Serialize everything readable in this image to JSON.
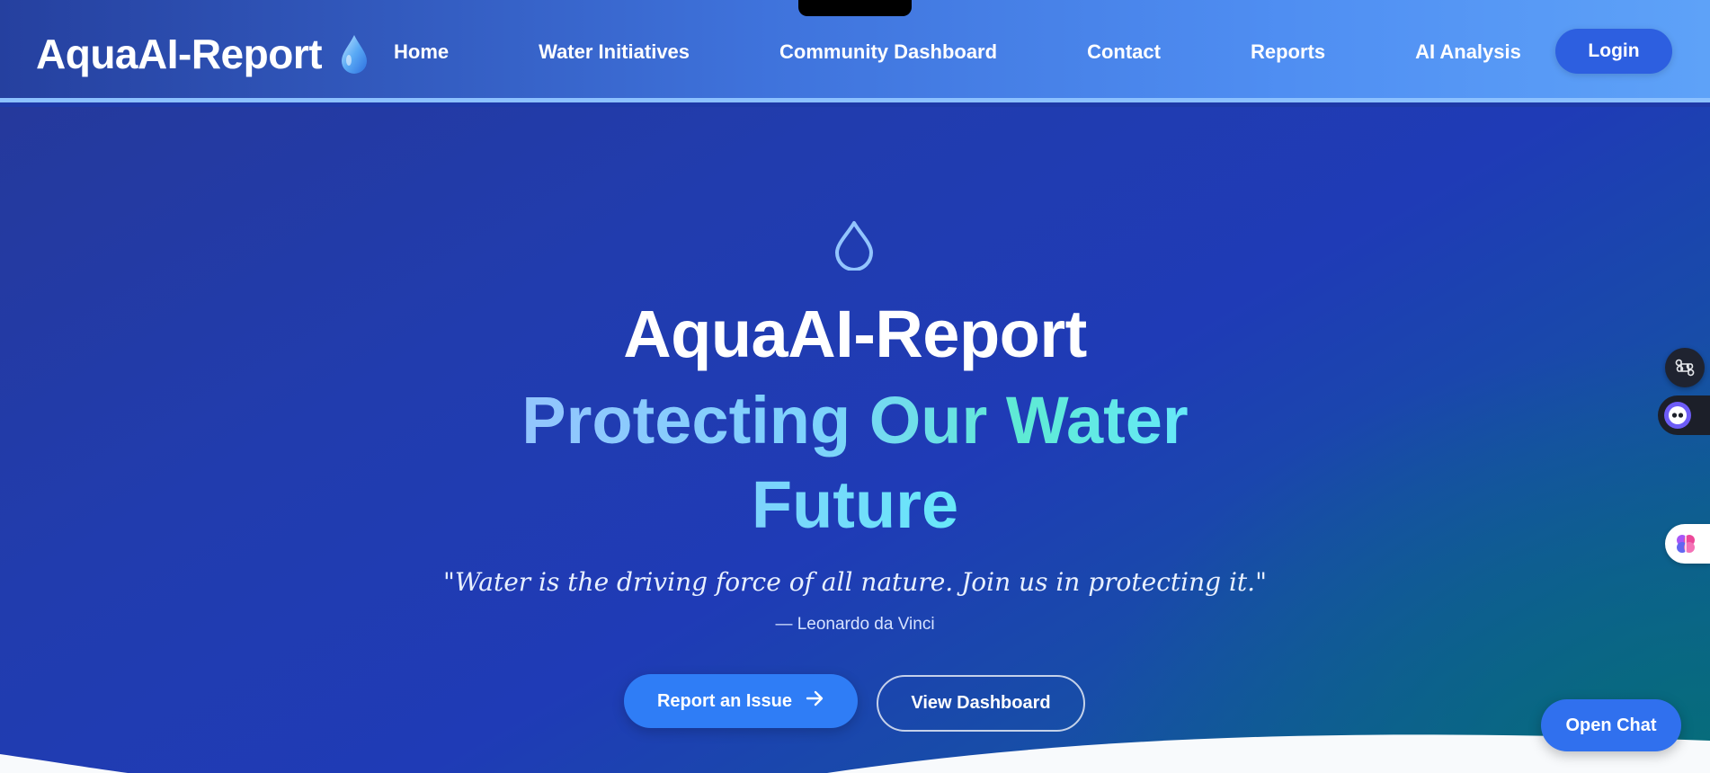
{
  "nav": {
    "brand": "AquaAI-Report",
    "links": [
      {
        "label": "Home"
      },
      {
        "label": "Water Initiatives"
      },
      {
        "label": "Community Dashboard"
      },
      {
        "label": "Contact"
      },
      {
        "label": "Reports"
      },
      {
        "label": "AI Analysis"
      }
    ],
    "login_label": "Login"
  },
  "hero": {
    "icon": "water-drop-outline-icon",
    "title": "AquaAI-Report",
    "subtitle_line1": "Protecting Our Water",
    "subtitle_line2": "Future",
    "quote": "\"Water is the driving force of all nature. Join us in protecting it.\"",
    "quote_author": "— Leonardo da Vinci",
    "report_button_label": "Report an Issue",
    "dashboard_button_label": "View Dashboard"
  },
  "floating": {
    "open_chat_label": "Open Chat",
    "icons": [
      "command-icon",
      "bot-icon",
      "brain-icon"
    ]
  },
  "colors": {
    "nav_gradient_start": "#25409f",
    "nav_gradient_end": "#5ea2f8",
    "hero_background": "#1f3bb6",
    "accent_button": "#2f7df6",
    "subtitle_gradient": [
      "#93c5fd",
      "#5eead4"
    ]
  }
}
